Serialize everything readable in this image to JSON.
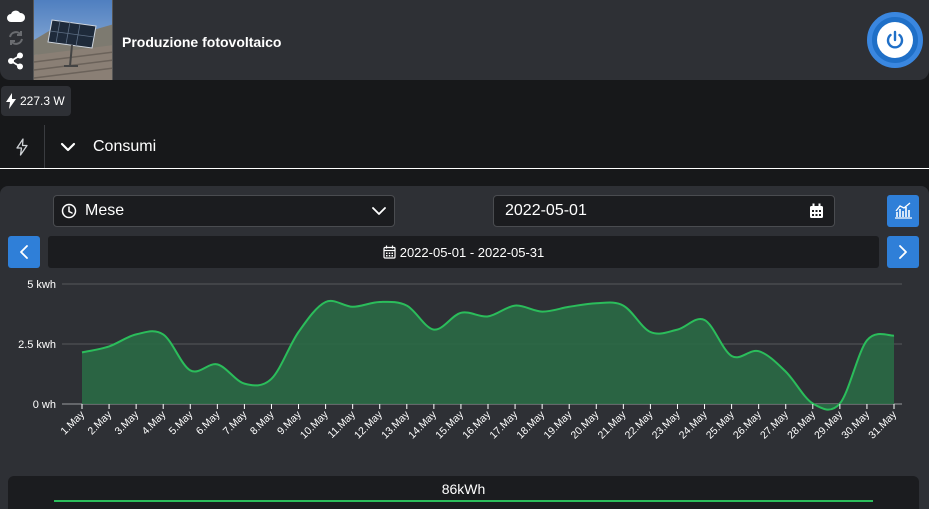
{
  "device": {
    "name": "Produzione fotovoltaico"
  },
  "live": {
    "power": "227.3 W"
  },
  "section": {
    "title": "Consumi"
  },
  "controls": {
    "period": "Mese",
    "date": "2022-05-01",
    "range": "2022-05-01 - 2022-05-31"
  },
  "colors": {
    "accent": "#2f7fd8",
    "series": "#2bbd5b",
    "fill": "#2a6a45"
  },
  "icons": [
    "cloud-icon",
    "sync-icon",
    "share-icon",
    "power-icon",
    "bolt-icon",
    "chevron-down-icon",
    "clock-icon",
    "calendar-icon",
    "chart-icon",
    "chevron-left-icon",
    "chevron-right-icon"
  ],
  "chart_data": {
    "type": "area",
    "categories": [
      "1.May",
      "2.May",
      "3.May",
      "4.May",
      "5.May",
      "6.May",
      "7.May",
      "8.May",
      "9.May",
      "10.May",
      "11.May",
      "12.May",
      "13.May",
      "14.May",
      "15.May",
      "16.May",
      "17.May",
      "18.May",
      "19.May",
      "20.May",
      "21.May",
      "22.May",
      "23.May",
      "24.May",
      "25.May",
      "26.May",
      "27.May",
      "28.May",
      "29.May",
      "30.May",
      "31.May"
    ],
    "values": [
      2.15,
      2.4,
      2.9,
      2.9,
      1.4,
      1.65,
      0.85,
      1.05,
      3.0,
      4.25,
      4.05,
      4.25,
      4.1,
      3.1,
      3.8,
      3.65,
      4.1,
      3.85,
      4.05,
      4.2,
      4.1,
      3.0,
      3.1,
      3.5,
      2.0,
      2.2,
      1.35,
      0.02,
      0.02,
      2.65,
      2.85
    ],
    "ylim": [
      0,
      5
    ],
    "yticks": [
      {
        "value": 0,
        "label": "0 wh"
      },
      {
        "value": 2.5,
        "label": "2.5 kwh"
      },
      {
        "value": 5,
        "label": "5 kwh"
      }
    ],
    "grid": true
  },
  "summary": {
    "total": "86kWh"
  }
}
